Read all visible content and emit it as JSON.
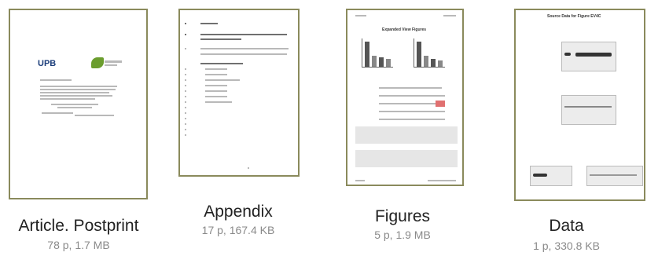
{
  "documents": [
    {
      "caption": "Article. Postprint",
      "meta": "78 p, 1.7 MB"
    },
    {
      "caption": "Appendix",
      "meta": "17 p, 167.4 KB"
    },
    {
      "caption": "Figures",
      "meta": "5 p, 1.9 MB"
    },
    {
      "caption": "Data",
      "meta": "1 p, 330.8 KB"
    }
  ],
  "thumbs": {
    "article_logo": "UPB",
    "figures_title": "Expanded View Figures",
    "data_title": "Source Data for Figure EV4C"
  },
  "colors": {
    "border": "#8a8a5c",
    "caption": "#222222",
    "meta": "#8a8a8a"
  }
}
